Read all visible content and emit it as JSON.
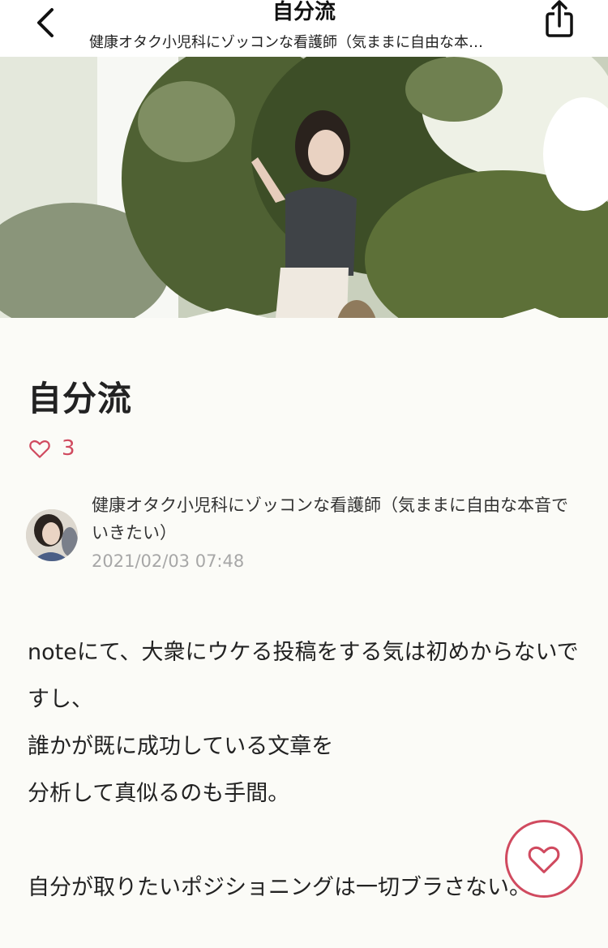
{
  "header": {
    "title": "自分流",
    "subtitle": "健康オタク小児科にゾッコンな看護師（気ままに自由な本…"
  },
  "article": {
    "title": "自分流",
    "like_count": "3",
    "author": "健康オタク小児科にゾッコンな看護師（気ままに自由な本音でいきたい）",
    "date": "2021/02/03 07:48",
    "body": [
      "noteにて、大衆にウケる投稿をする気は初めからないですし、",
      "誰かが既に成功している文章を",
      "分析して真似るのも手間。",
      "",
      "自分が取りたいポジショニングは一切ブラさない。"
    ]
  },
  "colors": {
    "accent": "#d04a5f",
    "background": "#fbfbf7",
    "meta_gray": "#a7a7a7"
  },
  "icons": {
    "back": "chevron-left-icon",
    "share": "share-icon",
    "like": "heart-icon"
  }
}
